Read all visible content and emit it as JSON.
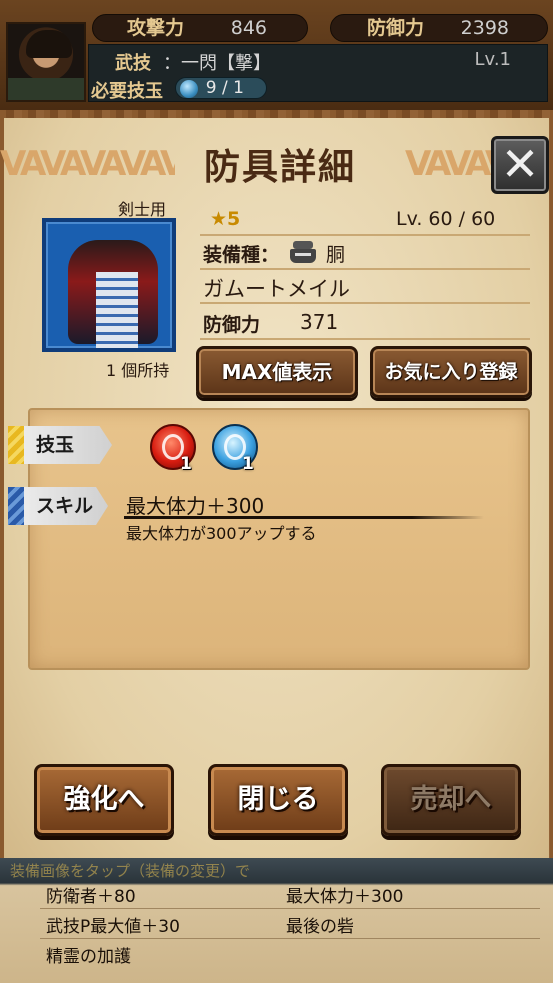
{
  "header": {
    "attack_label": "攻撃力",
    "attack_value": "846",
    "defense_label": "防御力",
    "defense_value": "2398",
    "skill_label": "武技",
    "skill_sep": "：",
    "skill_value": "一閃【撃】",
    "skill_level": "Lv.1",
    "required_gem_label": "必要技玉",
    "required_gem_value": "9 / 1"
  },
  "panel": {
    "title": "防具詳細",
    "close_label": "✕",
    "user_type": "剣士用",
    "owned_count": "1 個所持",
    "rarity": "★5",
    "level": "Lv. 60 / 60",
    "equip_type_label": "装備種：",
    "equip_type": "胴",
    "equip_name": "ガムートメイル",
    "defense_label": "防御力",
    "defense_value": "371",
    "max_button": "MAX値表示",
    "fav_button": "お気に入り登録"
  },
  "details": {
    "gem_tag": "技玉",
    "skill_tag": "スキル",
    "gems": [
      {
        "color": "#d81c10",
        "count": "1",
        "icon": "fire-gem-icon"
      },
      {
        "color": "#3aa0e0",
        "count": "1",
        "icon": "water-gem-icon"
      }
    ],
    "skill_name": "最大体力＋300",
    "skill_desc": "最大体力が300アップする"
  },
  "actions": {
    "enhance": "強化へ",
    "close": "閉じる",
    "sell": "売却へ"
  },
  "bottom": {
    "ticker": "装備画像をタップ（装備の変更）で",
    "skills": [
      "防衛者＋80",
      "最大体力＋300",
      "武技P最大値＋30",
      "最後の砦",
      "精霊の加護"
    ]
  }
}
